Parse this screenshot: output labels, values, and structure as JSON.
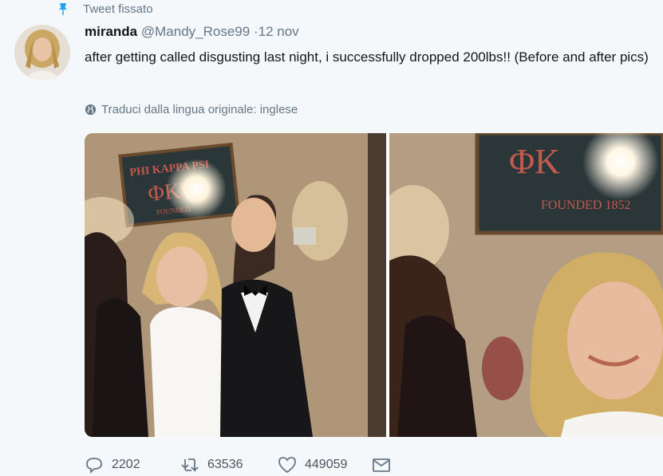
{
  "pinned": {
    "label": "Tweet fissato"
  },
  "tweet": {
    "display_name": "miranda",
    "handle": "@Mandy_Rose99",
    "separator": "·",
    "date": "12 nov",
    "text": "after getting called disgusting last night, i successfully dropped 200lbs!! (Before and after pics)",
    "translate_label": "Traduci dalla lingua originale: inglese",
    "photo1_sign": "PHI KAPPA PSI",
    "photo1_greek": "ΦΚΨ",
    "photo1_founded": "FOUNDED",
    "photo2_greek": "ΦΚ",
    "photo2_founded": "FOUNDED 1852"
  },
  "actions": {
    "reply_count": "2202",
    "retweet_count": "63536",
    "like_count": "449059"
  },
  "colors": {
    "accent": "#1da1f2",
    "muted": "#657786",
    "background": "#f5f8fa"
  },
  "icons": {
    "pin": "pin-icon",
    "globe": "globe-icon",
    "reply": "reply-icon",
    "retweet": "retweet-icon",
    "like": "heart-icon",
    "dm": "envelope-icon"
  }
}
